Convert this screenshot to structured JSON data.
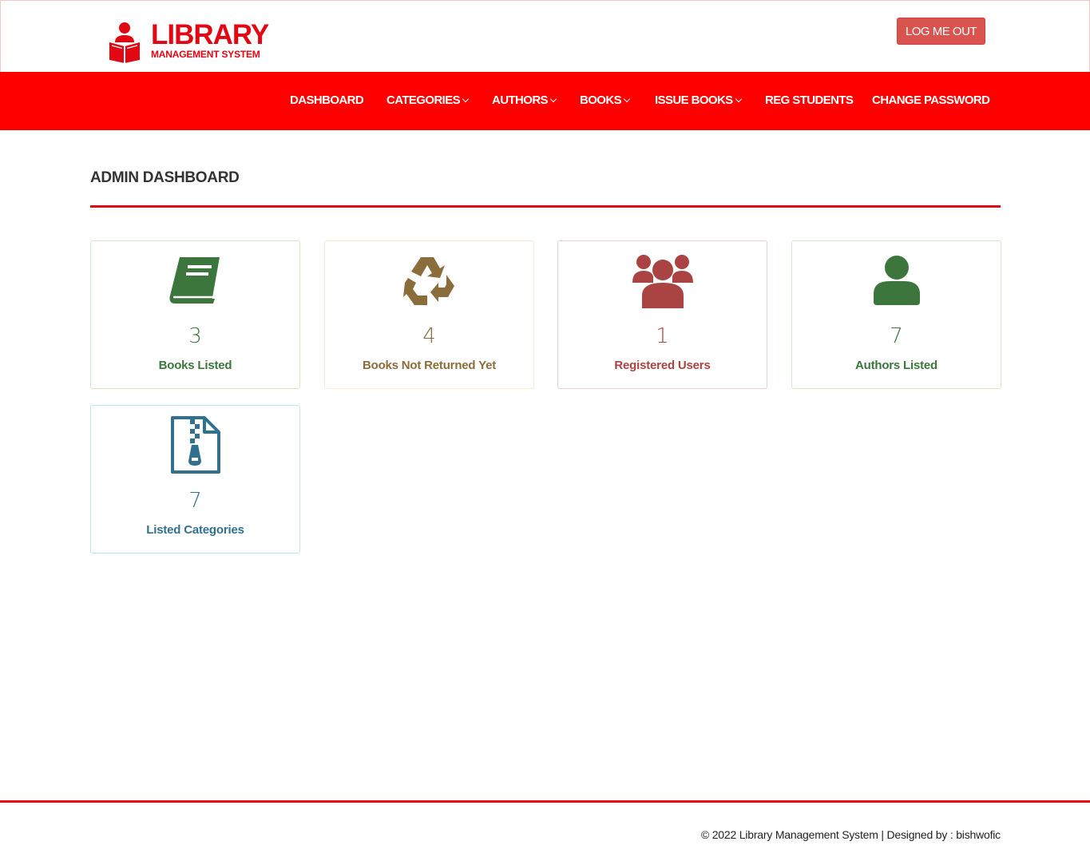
{
  "logo": {
    "title": "LIBRARY",
    "subtitle": "MANAGEMENT SYSTEM"
  },
  "header": {
    "logout_label": "LOG ME OUT"
  },
  "nav": {
    "items": [
      {
        "label": "DASHBOARD",
        "dropdown": false
      },
      {
        "label": "CATEGORIES",
        "dropdown": true
      },
      {
        "label": "AUTHORS",
        "dropdown": true
      },
      {
        "label": "BOOKS",
        "dropdown": true
      },
      {
        "label": "ISSUE BOOKS",
        "dropdown": true
      },
      {
        "label": "REG STUDENTS",
        "dropdown": false
      },
      {
        "label": "CHANGE PASSWORD",
        "dropdown": false
      }
    ]
  },
  "page": {
    "title": "ADMIN DASHBOARD"
  },
  "cards": [
    {
      "count": "3",
      "label": "Books Listed",
      "icon": "book-icon",
      "color": "#3c763d",
      "border": "#d6e9c6"
    },
    {
      "count": "4",
      "label": "Books Not Returned Yet",
      "icon": "recycle-icon",
      "color": "#8a6d3b",
      "border": "#faebcc"
    },
    {
      "count": "1",
      "label": "Registered Users",
      "icon": "users-icon",
      "color": "#a94442",
      "border": "#ebccd1"
    },
    {
      "count": "7",
      "label": "Authors Listed",
      "icon": "user-icon",
      "color": "#3c763d",
      "border": "#d6e9c6"
    },
    {
      "count": "7",
      "label": "Listed Categories",
      "icon": "file-zip-icon",
      "color": "#31708f",
      "border": "#bce8f1"
    }
  ],
  "footer": {
    "text": "© 2022 Library Management System | Designed by : bishwofic"
  },
  "colors": {
    "brand_red": "#e30613",
    "nav_red": "#ff0000",
    "logout_red": "#d9534f"
  }
}
